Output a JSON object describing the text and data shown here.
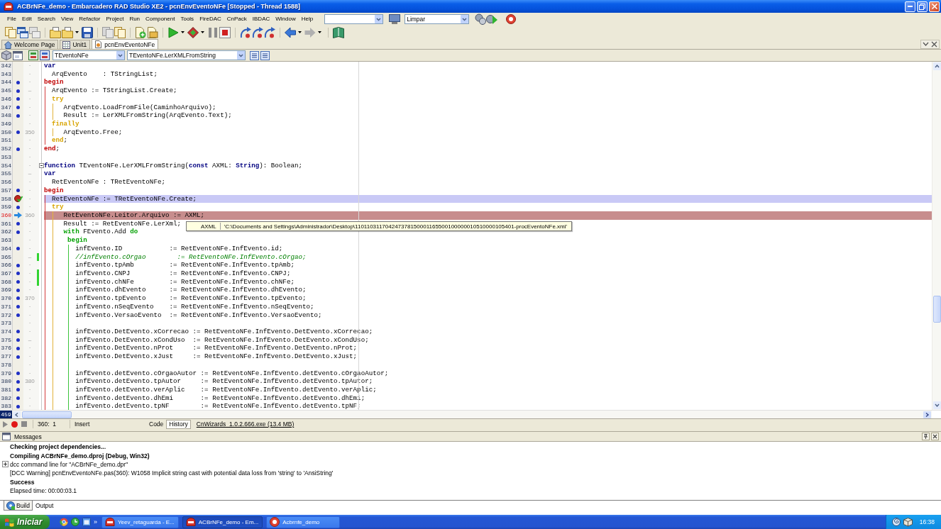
{
  "window": {
    "title": "ACBrNFe_demo - Embarcadero RAD Studio XE2 - pcnEnvEventoNFe [Stopped - Thread 1588]"
  },
  "menu_bar": {
    "items": [
      "File",
      "Edit",
      "Search",
      "View",
      "Refactor",
      "Project",
      "Run",
      "Component",
      "Tools",
      "FireDAC",
      "CnPack",
      "IBDAC",
      "Window",
      "Help"
    ],
    "layout_combo": "Limpar"
  },
  "document_tabs": [
    {
      "label": "Welcome Page",
      "kind": "home",
      "selected": false
    },
    {
      "label": "Unit1",
      "kind": "form",
      "selected": false
    },
    {
      "label": "pcnEnvEventoNFe",
      "kind": "unit",
      "selected": true
    }
  ],
  "editor_toolbar": {
    "class_combo": "TEventoNFe",
    "method_combo": "TEventoNFe.LerXMLFromString"
  },
  "editor": {
    "lines": [
      {
        "number": "342",
        "kind": "plain",
        "tick": "·",
        "changed": false,
        "fold": false,
        "begin_guide": false,
        "try_guide": false,
        "with_guide": false,
        "tokens": [
          {
            "kind": "keyword",
            "text": "var"
          }
        ]
      },
      {
        "number": "343",
        "kind": "plain",
        "tick": "·",
        "changed": false,
        "fold": false,
        "begin_guide": false,
        "try_guide": false,
        "with_guide": false,
        "tokens": [
          {
            "kind": "plain",
            "text": "  ArqEvento    : TStringList;"
          }
        ]
      },
      {
        "number": "344",
        "kind": "dot",
        "tick": "·",
        "changed": false,
        "fold": false,
        "begin_guide": false,
        "try_guide": false,
        "with_guide": false,
        "tokens": [
          {
            "kind": "level1",
            "text": "begin"
          }
        ]
      },
      {
        "number": "345",
        "kind": "dot",
        "tick": "–",
        "changed": false,
        "fold": false,
        "begin_guide": true,
        "try_guide": false,
        "with_guide": false,
        "tokens": [
          {
            "kind": "plain",
            "text": "  ArqEvento := TStringList.Create;"
          }
        ]
      },
      {
        "number": "346",
        "kind": "dot",
        "tick": "·",
        "changed": false,
        "fold": false,
        "begin_guide": true,
        "try_guide": false,
        "with_guide": false,
        "tokens": [
          {
            "kind": "level2",
            "text": "  try"
          }
        ]
      },
      {
        "number": "347",
        "kind": "dot",
        "tick": "·",
        "changed": false,
        "fold": false,
        "begin_guide": true,
        "try_guide": true,
        "with_guide": false,
        "tokens": [
          {
            "kind": "plain",
            "text": "     ArqEvento.LoadFromFile(CaminhoArquivo);"
          }
        ]
      },
      {
        "number": "348",
        "kind": "dot",
        "tick": "·",
        "changed": false,
        "fold": false,
        "begin_guide": true,
        "try_guide": true,
        "with_guide": false,
        "tokens": [
          {
            "kind": "plain",
            "text": "     Result := LerXMLFromString(ArqEvento.Text);"
          }
        ]
      },
      {
        "number": "349",
        "kind": "plain",
        "tick": "·",
        "changed": false,
        "fold": false,
        "begin_guide": true,
        "try_guide": false,
        "with_guide": false,
        "tokens": [
          {
            "kind": "level2",
            "text": "  finally"
          }
        ]
      },
      {
        "number": "350",
        "kind": "dot",
        "tick": "350",
        "changed": false,
        "fold": false,
        "begin_guide": true,
        "try_guide": true,
        "with_guide": false,
        "tokens": [
          {
            "kind": "plain",
            "text": "     ArqEvento.Free;"
          }
        ]
      },
      {
        "number": "351",
        "kind": "plain",
        "tick": "·",
        "changed": false,
        "fold": false,
        "begin_guide": true,
        "try_guide": false,
        "with_guide": false,
        "tokens": [
          {
            "kind": "level2",
            "text": "  end"
          },
          {
            "kind": "plain",
            "text": ";"
          }
        ]
      },
      {
        "number": "352",
        "kind": "dot",
        "tick": "·",
        "changed": false,
        "fold": false,
        "begin_guide": false,
        "try_guide": false,
        "with_guide": false,
        "tokens": [
          {
            "kind": "level1",
            "text": "end"
          },
          {
            "kind": "plain",
            "text": ";"
          }
        ]
      },
      {
        "number": "353",
        "kind": "plain",
        "tick": "·",
        "changed": false,
        "fold": false,
        "begin_guide": false,
        "try_guide": false,
        "with_guide": false
      },
      {
        "number": "354",
        "kind": "plain",
        "tick": "·",
        "changed": false,
        "fold": true,
        "begin_guide": false,
        "try_guide": false,
        "with_guide": false,
        "tokens": [
          {
            "kind": "keyword",
            "text": "function"
          },
          {
            "kind": "plain",
            "text": " TEventoNFe.LerXMLFromString("
          },
          {
            "kind": "keyword",
            "text": "const"
          },
          {
            "kind": "plain",
            "text": " AXML: "
          },
          {
            "kind": "keyword",
            "text": "String"
          },
          {
            "kind": "plain",
            "text": "): Boolean;"
          }
        ]
      },
      {
        "number": "355",
        "kind": "plain",
        "tick": "–",
        "changed": false,
        "fold": false,
        "begin_guide": false,
        "try_guide": false,
        "with_guide": false,
        "tokens": [
          {
            "kind": "keyword",
            "text": "var"
          }
        ]
      },
      {
        "number": "356",
        "kind": "plain",
        "tick": "·",
        "changed": false,
        "fold": false,
        "begin_guide": false,
        "try_guide": false,
        "with_guide": false,
        "tokens": [
          {
            "kind": "plain",
            "text": "  RetEventoNFe : TRetEventoNFe;"
          }
        ]
      },
      {
        "number": "357",
        "kind": "dot",
        "tick": "·",
        "changed": false,
        "fold": false,
        "begin_guide": false,
        "try_guide": false,
        "with_guide": false,
        "tokens": [
          {
            "kind": "level1",
            "text": "begin"
          }
        ]
      },
      {
        "number": "358",
        "kind": "breakpoint",
        "tick": "·",
        "changed": false,
        "fold": false,
        "begin_guide": true,
        "try_guide": false,
        "with_guide": false,
        "tokens": [
          {
            "kind": "plain",
            "text": "  RetEventoNFe := TRetEventoNFe.Create;"
          }
        ]
      },
      {
        "number": "359",
        "kind": "dot",
        "tick": "·",
        "changed": false,
        "fold": false,
        "begin_guide": true,
        "try_guide": false,
        "with_guide": false,
        "tokens": [
          {
            "kind": "level2",
            "text": "  try"
          }
        ]
      },
      {
        "number": "360",
        "kind": "execution",
        "tick": "360",
        "changed": false,
        "fold": false,
        "begin_guide": true,
        "try_guide": true,
        "with_guide": false,
        "tokens": [
          {
            "kind": "plain",
            "text": "     RetEventoNFe.Leitor.Arquivo := AXML;"
          }
        ]
      },
      {
        "number": "361",
        "kind": "dot",
        "tick": "·",
        "changed": false,
        "fold": false,
        "begin_guide": true,
        "try_guide": true,
        "with_guide": false,
        "tokens": [
          {
            "kind": "plain",
            "text": "     Result := RetEventoNFe.LerXml;"
          }
        ]
      },
      {
        "number": "362",
        "kind": "dot",
        "tick": "·",
        "changed": false,
        "fold": false,
        "begin_guide": true,
        "try_guide": true,
        "with_guide": false,
        "tokens": [
          {
            "kind": "level3",
            "text": "     with"
          },
          {
            "kind": "plain",
            "text": " FEvento.Add "
          },
          {
            "kind": "level3",
            "text": "do"
          }
        ]
      },
      {
        "number": "363",
        "kind": "plain",
        "tick": "·",
        "changed": false,
        "fold": false,
        "begin_guide": true,
        "try_guide": true,
        "with_guide": false,
        "tokens": [
          {
            "kind": "level3",
            "text": "      begin"
          }
        ]
      },
      {
        "number": "364",
        "kind": "dot",
        "tick": "·",
        "changed": false,
        "fold": false,
        "begin_guide": true,
        "try_guide": true,
        "with_guide": true,
        "tokens": [
          {
            "kind": "plain",
            "text": "        infEvento.ID            := RetEventoNFe.InfEvento.id;"
          }
        ]
      },
      {
        "number": "365",
        "kind": "plain",
        "tick": "–",
        "changed": true,
        "fold": false,
        "begin_guide": true,
        "try_guide": true,
        "with_guide": true,
        "tokens": [
          {
            "kind": "comment",
            "text": "        //infEvento.cOrgao        := RetEventoNFe.InfEvento.cOrgao;"
          }
        ]
      },
      {
        "number": "366",
        "kind": "dot",
        "tick": "·",
        "changed": false,
        "fold": false,
        "begin_guide": true,
        "try_guide": true,
        "with_guide": true,
        "tokens": [
          {
            "kind": "plain",
            "text": "        infEvento.tpAmb         := RetEventoNFe.InfEvento.tpAmb;"
          }
        ]
      },
      {
        "number": "367",
        "kind": "dot",
        "tick": "·",
        "changed": true,
        "fold": false,
        "begin_guide": true,
        "try_guide": true,
        "with_guide": true,
        "tokens": [
          {
            "kind": "plain",
            "text": "        infEvento.CNPJ          := RetEventoNFe.InfEvento.CNPJ;"
          }
        ]
      },
      {
        "number": "368",
        "kind": "dot",
        "tick": "·",
        "changed": true,
        "fold": false,
        "begin_guide": true,
        "try_guide": true,
        "with_guide": true,
        "tokens": [
          {
            "kind": "plain",
            "text": "        infEvento.chNFe         := RetEventoNFe.InfEvento.chNFe;"
          }
        ]
      },
      {
        "number": "369",
        "kind": "dot",
        "tick": "·",
        "changed": false,
        "fold": false,
        "begin_guide": true,
        "try_guide": true,
        "with_guide": true,
        "tokens": [
          {
            "kind": "plain",
            "text": "        infEvento.dhEvento      := RetEventoNFe.InfEvento.dhEvento;"
          }
        ]
      },
      {
        "number": "370",
        "kind": "dot",
        "tick": "370",
        "changed": false,
        "fold": false,
        "begin_guide": true,
        "try_guide": true,
        "with_guide": true,
        "tokens": [
          {
            "kind": "plain",
            "text": "        infEvento.tpEvento      := RetEventoNFe.InfEvento.tpEvento;"
          }
        ]
      },
      {
        "number": "371",
        "kind": "dot",
        "tick": "·",
        "changed": false,
        "fold": false,
        "begin_guide": true,
        "try_guide": true,
        "with_guide": true,
        "tokens": [
          {
            "kind": "plain",
            "text": "        infEvento.nSeqEvento    := RetEventoNFe.InfEvento.nSeqEvento;"
          }
        ]
      },
      {
        "number": "372",
        "kind": "dot",
        "tick": "·",
        "changed": false,
        "fold": false,
        "begin_guide": true,
        "try_guide": true,
        "with_guide": true,
        "tokens": [
          {
            "kind": "plain",
            "text": "        infEvento.VersaoEvento  := RetEventoNFe.InfEvento.VersaoEvento;"
          }
        ]
      },
      {
        "number": "373",
        "kind": "plain",
        "tick": "·",
        "changed": false,
        "fold": false,
        "begin_guide": true,
        "try_guide": true,
        "with_guide": true
      },
      {
        "number": "374",
        "kind": "dot",
        "tick": "·",
        "changed": false,
        "fold": false,
        "begin_guide": true,
        "try_guide": true,
        "with_guide": true,
        "tokens": [
          {
            "kind": "plain",
            "text": "        infEvento.DetEvento.xCorrecao := RetEventoNFe.InfEvento.DetEvento.xCorrecao;"
          }
        ]
      },
      {
        "number": "375",
        "kind": "dot",
        "tick": "–",
        "changed": false,
        "fold": false,
        "begin_guide": true,
        "try_guide": true,
        "with_guide": true,
        "tokens": [
          {
            "kind": "plain",
            "text": "        infEvento.DetEvento.xCondUso  := RetEventoNFe.InfEvento.DetEvento.xCondUso;"
          }
        ]
      },
      {
        "number": "376",
        "kind": "dot",
        "tick": "·",
        "changed": false,
        "fold": false,
        "begin_guide": true,
        "try_guide": true,
        "with_guide": true,
        "tokens": [
          {
            "kind": "plain",
            "text": "        infEvento.DetEvento.nProt     := RetEventoNFe.InfEvento.DetEvento.nProt;"
          }
        ]
      },
      {
        "number": "377",
        "kind": "dot",
        "tick": "·",
        "changed": false,
        "fold": false,
        "begin_guide": true,
        "try_guide": true,
        "with_guide": true,
        "tokens": [
          {
            "kind": "plain",
            "text": "        infEvento.DetEvento.xJust     := RetEventoNFe.InfEvento.DetEvento.xJust;"
          }
        ]
      },
      {
        "number": "378",
        "kind": "plain",
        "tick": "·",
        "changed": false,
        "fold": false,
        "begin_guide": true,
        "try_guide": true,
        "with_guide": true
      },
      {
        "number": "379",
        "kind": "dot",
        "tick": "·",
        "changed": false,
        "fold": false,
        "begin_guide": true,
        "try_guide": true,
        "with_guide": true,
        "tokens": [
          {
            "kind": "plain",
            "text": "        infEvento.detEvento.cOrgaoAutor := RetEventoNFe.InfEvento.detEvento.cOrgaoAutor;"
          }
        ]
      },
      {
        "number": "380",
        "kind": "dot",
        "tick": "380",
        "changed": false,
        "fold": false,
        "begin_guide": true,
        "try_guide": true,
        "with_guide": true,
        "tokens": [
          {
            "kind": "plain",
            "text": "        infEvento.detEvento.tpAutor     := RetEventoNFe.InfEvento.detEvento.tpAutor;"
          }
        ]
      },
      {
        "number": "381",
        "kind": "dot",
        "tick": "·",
        "changed": false,
        "fold": false,
        "begin_guide": true,
        "try_guide": true,
        "with_guide": true,
        "tokens": [
          {
            "kind": "plain",
            "text": "        infEvento.detEvento.verAplic    := RetEventoNFe.InfEvento.detEvento.verAplic;"
          }
        ]
      },
      {
        "number": "382",
        "kind": "dot",
        "tick": "·",
        "changed": false,
        "fold": false,
        "begin_guide": true,
        "try_guide": true,
        "with_guide": true,
        "tokens": [
          {
            "kind": "plain",
            "text": "        infEvento.detEvento.dhEmi       := RetEventoNFe.InfEvento.detEvento.dhEmi;"
          }
        ]
      },
      {
        "number": "383",
        "kind": "dot",
        "tick": "·",
        "changed": false,
        "fold": false,
        "begin_guide": true,
        "try_guide": true,
        "with_guide": true,
        "tokens": [
          {
            "kind": "plain",
            "text": "        infEvento.detEvento.tpNF        := RetEventoNFe.InfEvento.detEvento.tpNF;"
          }
        ]
      }
    ],
    "tooltip": {
      "name": "AXML",
      "value": "'C:\\Documents and Settings\\Administrador\\Desktop\\110110311704247378150001165500100000010510000105401-procEventoNFe.xml'"
    },
    "line_count": "459"
  },
  "status_bar": {
    "position": "360:  1",
    "mode": "Insert",
    "view_tabs": [
      {
        "label": "Code",
        "selected": true
      },
      {
        "label": "History",
        "selected": false
      }
    ],
    "link": "CnWizards_1.0.2.666.exe (13.4 MB)"
  },
  "messages": {
    "title": "Messages",
    "items": [
      {
        "kind": "heading",
        "text": "Checking project dependencies..."
      },
      {
        "kind": "heading",
        "text": "Compiling ACBrNFe_demo.dproj (Debug, Win32)"
      },
      {
        "kind": "group",
        "text": "dcc command line for \"ACBrNFe_demo.dpr\"",
        "expanded": false
      },
      {
        "kind": "plain",
        "text": "[DCC Warning] pcnEnvEventoNFe.pas(360): W1058 Implicit string cast with potential data loss from 'string' to 'AnsiString'"
      },
      {
        "kind": "heading",
        "text": "Success"
      },
      {
        "kind": "plain",
        "text": "Elapsed time: 00:00:03.1"
      }
    ]
  },
  "bottom_tabs": [
    {
      "label": "Build",
      "selected": true
    },
    {
      "label": "Output",
      "selected": false
    }
  ],
  "taskbar": {
    "start": "Iniciar",
    "overflow": "»",
    "tasks": [
      {
        "label": "Yeev_retaguarda - E...",
        "kind": "ide",
        "selected": false
      },
      {
        "label": "ACBrNFe_demo - Em...",
        "kind": "ide",
        "selected": true
      },
      {
        "label": "Acbrnfe_demo",
        "kind": "app",
        "selected": false
      }
    ],
    "clock": "16:38"
  }
}
